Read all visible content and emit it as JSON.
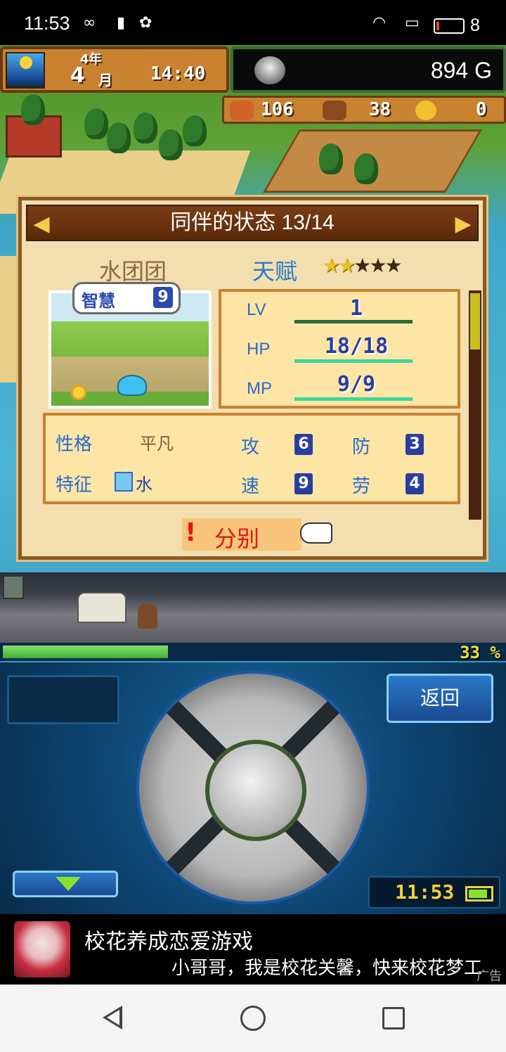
{
  "status_bar": {
    "time": "11:53",
    "battery_level": "8",
    "icons": [
      "infinity-icon",
      "sim-alert-icon",
      "paw-icon",
      "wifi-icon",
      "screen-icon",
      "battery-icon"
    ]
  },
  "hud": {
    "year": "4年",
    "month": "4",
    "month_unit": "月",
    "clock": "14:40",
    "gold": "894 G",
    "resources": {
      "food": "106",
      "wood": "38",
      "medal": "0"
    }
  },
  "panel": {
    "title": "同伴的状态 13/14",
    "companion_name": "水团团",
    "talent_label": "天赋",
    "talent_stars_filled": 2,
    "talent_stars_total": 5,
    "wisdom_label": "智慧",
    "wisdom_value": "9",
    "stats": {
      "lv_label": "LV",
      "lv_value": "1",
      "hp_label": "HP",
      "hp_value": "18/18",
      "mp_label": "MP",
      "mp_value": "9/9"
    },
    "attributes": {
      "personality_label": "性格",
      "personality_value": "平凡",
      "trait_label": "特征",
      "trait_value": "水",
      "atk_label": "攻",
      "atk_value": "6",
      "def_label": "防",
      "def_value": "3",
      "spd_label": "速",
      "spd_value": "9",
      "labor_label": "劳",
      "labor_value": "4"
    },
    "part_button": "分别"
  },
  "travel": {
    "progress_percent": 33,
    "progress_text": "33 %"
  },
  "controls": {
    "back_button": "返回",
    "clock": "11:53"
  },
  "ad": {
    "title": "校花养成恋爱游戏",
    "subtitle": "小哥哥，我是校花关馨，快来校花梦工",
    "tag": "广告"
  },
  "colors": {
    "panel_bg": "#f3deb0",
    "panel_border": "#8a5a24",
    "stat_label_blue": "#2a6ad0",
    "part_red": "#e01818",
    "progress_green": "#3ab03a"
  }
}
